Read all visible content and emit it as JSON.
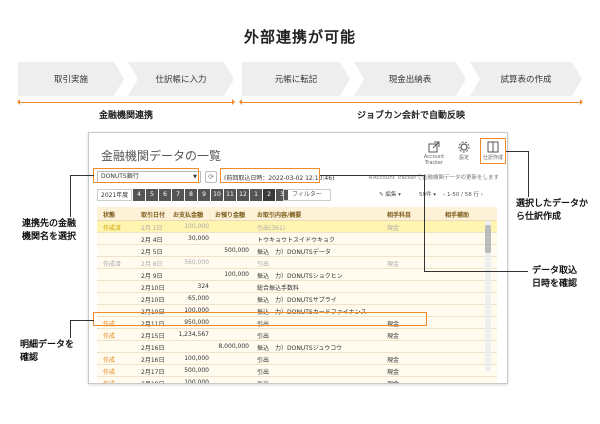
{
  "title": "外部連携が可能",
  "flow": {
    "steps_left": [
      "取引実施",
      "仕訳帳に入力"
    ],
    "steps_right": [
      "元帳に転記",
      "現金出納表",
      "試算表の作成"
    ],
    "label_left": "金融機関連携",
    "label_right": "ジョブカン会計で自動反映"
  },
  "window": {
    "title": "金融機関データの一覧",
    "tools": {
      "account_tracker": "Account Tracker",
      "settings": "設定",
      "journal": "仕訳作成"
    },
    "bank_select": "DONUTS銀行",
    "acquired_datetime": "(前回取込日時：2022-03-02 12:10:46)",
    "tracker_note": "※Account Trackerで金融機関データの更新をします",
    "year": "2021年度",
    "months": [
      "4",
      "5",
      "6",
      "7",
      "8",
      "9",
      "10",
      "11",
      "12",
      "1",
      "2",
      "3"
    ],
    "filter_label": "フィルター",
    "edit_label": "編集",
    "per_page": "50件",
    "paging": "1-50 / 58 行",
    "columns": [
      "状態",
      "取引日付",
      "お支払金額",
      "お預り金額",
      "お取引内容/摘要",
      "相手科目",
      "相手補助"
    ],
    "rows": [
      {
        "status": "作成済",
        "date": "2月 1日",
        "pay": "100,000",
        "deposit": "",
        "desc": "引出(361)",
        "account": "現金",
        "dim": true,
        "sel": true
      },
      {
        "status": "",
        "date": "2月 4日",
        "pay": "30,000",
        "deposit": "",
        "desc": "トウキョウトスイドウキョク",
        "account": "",
        "dim": false,
        "sel": false
      },
      {
        "status": "",
        "date": "2月 5日",
        "pay": "",
        "deposit": "500,000",
        "desc": "振込　力）DONUTSデータ",
        "account": "",
        "dim": false,
        "sel": false
      },
      {
        "status": "作成済",
        "date": "2月 8日",
        "pay": "560,000",
        "deposit": "",
        "desc": "引出",
        "account": "現金",
        "dim": true,
        "sel": false
      },
      {
        "status": "",
        "date": "2月 9日",
        "pay": "",
        "deposit": "100,000",
        "desc": "振込　力）DONUTSショクヒン",
        "account": "",
        "dim": false,
        "sel": false
      },
      {
        "status": "",
        "date": "2月10日",
        "pay": "324",
        "deposit": "",
        "desc": "総合振込手数料",
        "account": "",
        "dim": false,
        "sel": false
      },
      {
        "status": "",
        "date": "2月10日",
        "pay": "65,000",
        "deposit": "",
        "desc": "振込　力）DONUTSサプライ",
        "account": "",
        "dim": false,
        "sel": false
      },
      {
        "status": "",
        "date": "2月10日",
        "pay": "100,000",
        "deposit": "",
        "desc": "振込　力）DONUTSカードファイナンス",
        "account": "",
        "dim": false,
        "sel": false
      },
      {
        "status": "作成",
        "date": "2月11日",
        "pay": "950,000",
        "deposit": "",
        "desc": "引出",
        "account": "現金",
        "dim": false,
        "sel": false
      },
      {
        "status": "作成",
        "date": "2月15日",
        "pay": "1,234,567",
        "deposit": "",
        "desc": "引出",
        "account": "現金",
        "dim": false,
        "sel": false
      },
      {
        "status": "",
        "date": "2月16日",
        "pay": "",
        "deposit": "8,000,000",
        "desc": "振込　力）DONUTSジュウコウ",
        "account": "",
        "dim": false,
        "sel": false
      },
      {
        "status": "作成",
        "date": "2月16日",
        "pay": "100,000",
        "deposit": "",
        "desc": "引出",
        "account": "現金",
        "dim": false,
        "sel": false
      },
      {
        "status": "作成",
        "date": "2月17日",
        "pay": "500,000",
        "deposit": "",
        "desc": "引出",
        "account": "現金",
        "dim": false,
        "sel": false
      },
      {
        "status": "作成",
        "date": "2月18日",
        "pay": "100,000",
        "deposit": "",
        "desc": "引出",
        "account": "現金",
        "dim": false,
        "sel": false
      }
    ]
  },
  "callouts": {
    "bank": "連携先の金融\n機関名を選択",
    "detail": "明細データを\n確認",
    "journal": "選択したデータか\nら仕訳作成",
    "datetime": "データ取込\n日時を確認"
  },
  "colors": {
    "accent": "#f08a2a",
    "header_bg": "#fdf1d8",
    "selected_row": "#fff4b0"
  }
}
